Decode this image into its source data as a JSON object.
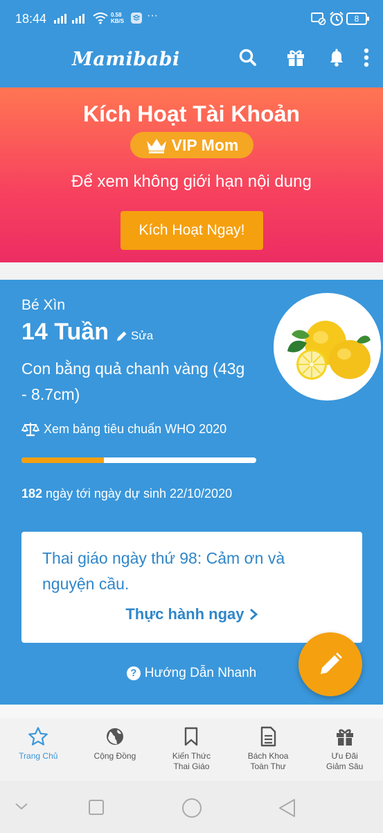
{
  "status_bar": {
    "time": "18:44",
    "net_speed_value": "0.58",
    "net_speed_unit": "KB/S",
    "more": "···",
    "battery": "8"
  },
  "app_bar": {
    "logo": "Mamibabi",
    "icons": [
      "search-icon",
      "gift-icon",
      "bell-icon",
      "more-vert-icon"
    ]
  },
  "banner": {
    "title": "Kích Hoạt Tài Khoản",
    "vip_label": "VIP Mom",
    "subtitle": "Để xem không giới hạn nội dung",
    "button_label": "Kích Hoạt Ngay!"
  },
  "baby": {
    "name": "Bé Xìn",
    "weeks": "14 Tuần",
    "edit_label": "Sửa",
    "compare_text": "Con bằng quả chanh vàng (43g - 8.7cm)",
    "who_link": "Xem bảng tiêu chuẩn WHO 2020",
    "progress_fraction": 0.35,
    "days_left": "182",
    "countdown_text": " ngày tới ngày dự sinh 22/10/2020"
  },
  "lesson": {
    "text": "Thai giáo ngày thứ 98: Cảm ơn và nguyện cầu.",
    "cta": "Thực hành ngay"
  },
  "guide_link": "Hướng Dẫn Nhanh",
  "tabs": [
    {
      "label": "Trang Chủ",
      "icon": "star-icon",
      "active": true
    },
    {
      "label": "Cộng Đồng",
      "icon": "globe-icon",
      "active": false
    },
    {
      "label": "Kiến Thức\nThai Giáo",
      "icon": "bookmark-icon",
      "active": false
    },
    {
      "label": "Bách Khoa\nToàn Thư",
      "icon": "document-icon",
      "active": false
    },
    {
      "label": "Ưu Đãi\nGiảm Sâu",
      "icon": "gift-icon",
      "active": false
    }
  ],
  "colors": {
    "primary": "#3a97db",
    "accent": "#f5a00f",
    "banner_top": "#ff7652",
    "banner_bottom": "#ec2d62"
  }
}
